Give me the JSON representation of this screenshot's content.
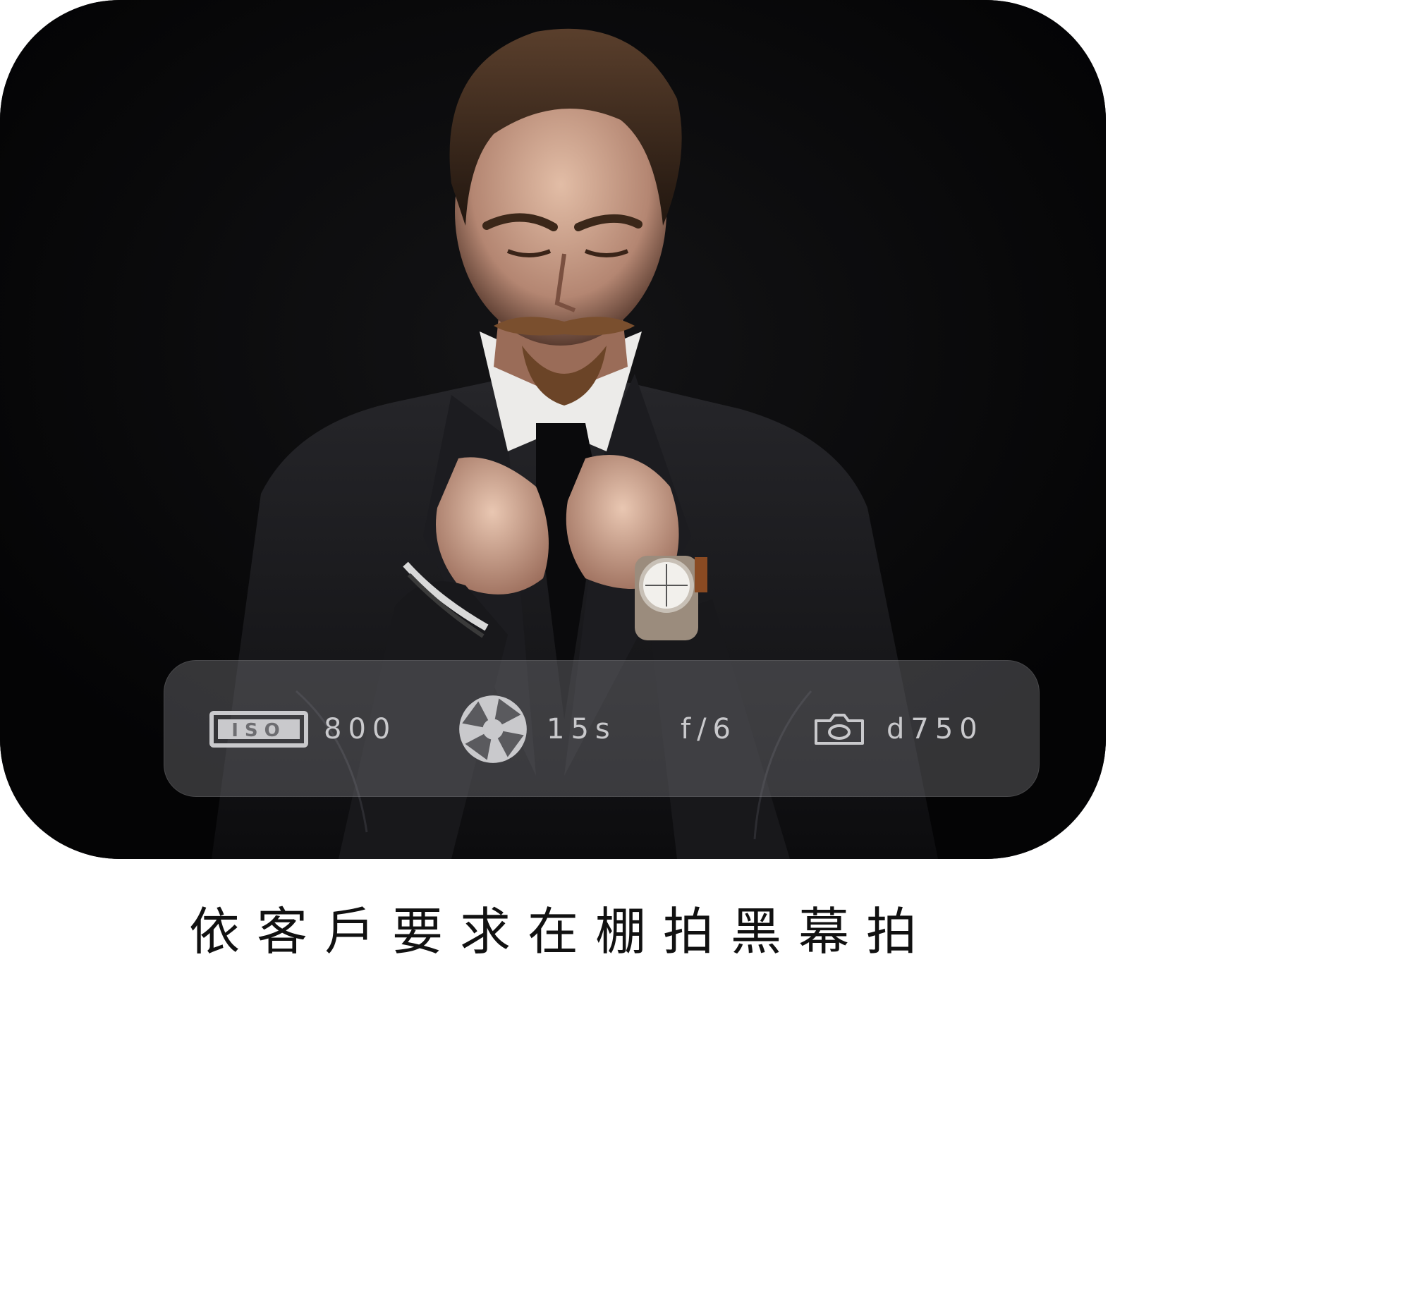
{
  "photo": {
    "subject": "portrait-photo"
  },
  "exif": {
    "iso_badge": "ISO",
    "iso_value": "800",
    "shutter_value": "15s",
    "aperture_value": "f/6",
    "camera_value": "d750",
    "icons": [
      "iso-badge-icon",
      "aperture-icon",
      "camera-icon"
    ]
  },
  "caption": {
    "text": "依客戶要求在棚拍黑幕拍"
  },
  "colors": {
    "background": "#050506",
    "bar_text": "#c9c9cc",
    "caption_text": "#111111"
  }
}
